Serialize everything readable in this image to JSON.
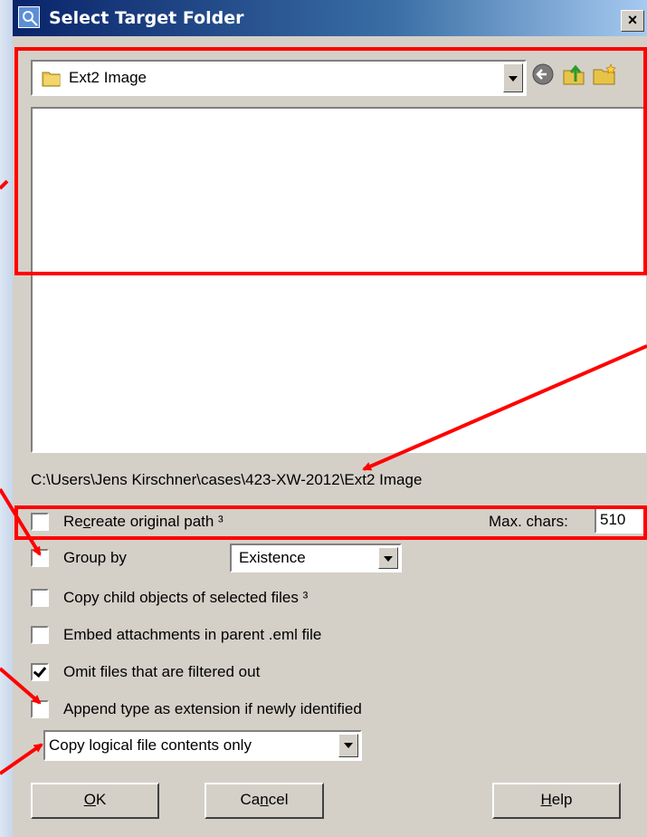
{
  "window": {
    "title": "Select Target Folder",
    "close_glyph": "×"
  },
  "folder_combo": {
    "value": "Ext2 Image"
  },
  "nav_icons": [
    "back-icon",
    "up-folder-icon",
    "new-folder-icon"
  ],
  "path": "C:\\Users\\Jens Kirschner\\cases\\423-XW-2012\\Ext2 Image",
  "options": {
    "recreate_path": {
      "pre": "Re",
      "u": "c",
      "post": "reate original path ³",
      "checked": false
    },
    "max_chars": {
      "label": "Max. chars:",
      "value": "510"
    },
    "group_by": {
      "label": "Group by",
      "checked": false,
      "select_value": "Existence"
    },
    "copy_child": {
      "label": "Copy child objects of selected files ³",
      "checked": false
    },
    "embed_attachments": {
      "label": "Embed attachments in parent .eml file",
      "checked": false
    },
    "omit_filtered": {
      "label": "Omit files that are filtered out",
      "checked": true
    },
    "append_type": {
      "label": "Append type as extension if newly identified",
      "checked": false
    }
  },
  "copy_mode": {
    "value": "Copy logical file contents only"
  },
  "buttons": {
    "ok": {
      "u": "O",
      "post": "K"
    },
    "cancel": {
      "pre": "Ca",
      "u": "n",
      "post": "cel"
    },
    "help": {
      "u": "H",
      "post": "elp"
    }
  },
  "colors": {
    "annotation": "#ff0000",
    "dialog_bg": "#d4d0c8",
    "title_start": "#0a246a"
  }
}
